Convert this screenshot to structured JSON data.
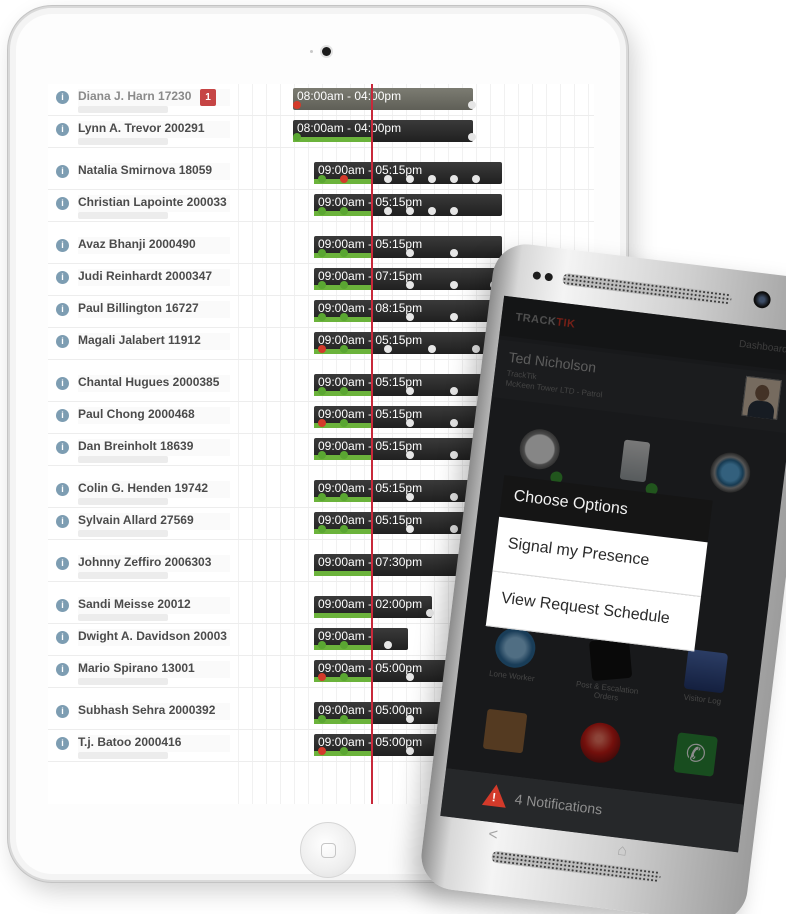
{
  "scheduler": {
    "employees": [
      {
        "name": "Diana J. Harn 17230",
        "shift": "08:00am - 04:00pm",
        "badge": "1"
      },
      {
        "name": "Lynn A. Trevor 200291",
        "shift": "08:00am - 04:00pm"
      },
      {
        "name": "Natalia Smirnova 18059",
        "shift": "09:00am - 05:15pm"
      },
      {
        "name": "Christian Lapointe 200033",
        "shift": "09:00am - 05:15pm"
      },
      {
        "name": "Avaz Bhanji 2000490",
        "shift": "09:00am - 05:15pm"
      },
      {
        "name": "Judi Reinhardt 2000347",
        "shift": "09:00am - 07:15pm"
      },
      {
        "name": "Paul Billington 16727",
        "shift": "09:00am - 08:15pm"
      },
      {
        "name": "Magali Jalabert 11912",
        "shift": "09:00am - 05:15pm"
      },
      {
        "name": "Chantal Hugues 2000385",
        "shift": "09:00am - 05:15pm"
      },
      {
        "name": "Paul Chong 2000468",
        "shift": "09:00am - 05:15pm"
      },
      {
        "name": "Dan Breinholt 18639",
        "shift": "09:00am - 05:15pm"
      },
      {
        "name": "Colin G. Henden 19742",
        "shift": "09:00am - 05:15pm"
      },
      {
        "name": "Sylvain Allard 27569",
        "shift": "09:00am - 05:15pm"
      },
      {
        "name": "Johnny Zeffiro 2006303",
        "shift": "09:00am - 07:30pm"
      },
      {
        "name": "Sandi Meisse 20012",
        "shift": "09:00am - 02:00pm"
      },
      {
        "name": "Dwight A. Davidson 20003",
        "shift": "09:00am -"
      },
      {
        "name": "Mario Spirano 13001",
        "shift": "09:00am - 05:00pm"
      },
      {
        "name": "Subhash Sehra 2000392",
        "shift": "09:00am - 05:00pm"
      },
      {
        "name": "T.j. Batoo 2000416",
        "shift": "09:00am - 05:00pm"
      }
    ]
  },
  "phone_app": {
    "logo": {
      "part1": "TRACK",
      "part2": "TIK"
    },
    "dashboard_link": "Dashboard",
    "profile": {
      "name": "Ted Nicholson",
      "company": "TrackTik",
      "location": "McKeen Tower LTD - Patrol"
    },
    "tiles": {
      "lone_worker": "Lone Worker",
      "escalation": "Post & Escalation Orders",
      "visitor_log": "Visitor Log"
    },
    "dialog": {
      "title": "Choose Options",
      "option1": "Signal my Presence",
      "option2": "View Request Schedule"
    },
    "notifications": {
      "count_text": "4 Notifications",
      "icon_char": "!"
    },
    "nav": {
      "back": "<",
      "home": "⌂"
    }
  },
  "colors": {
    "progress_green": "#6bb33b",
    "now_line_red": "#c8283a",
    "alert_red": "#d33a2a",
    "shift_bar_dark": "#262626"
  }
}
